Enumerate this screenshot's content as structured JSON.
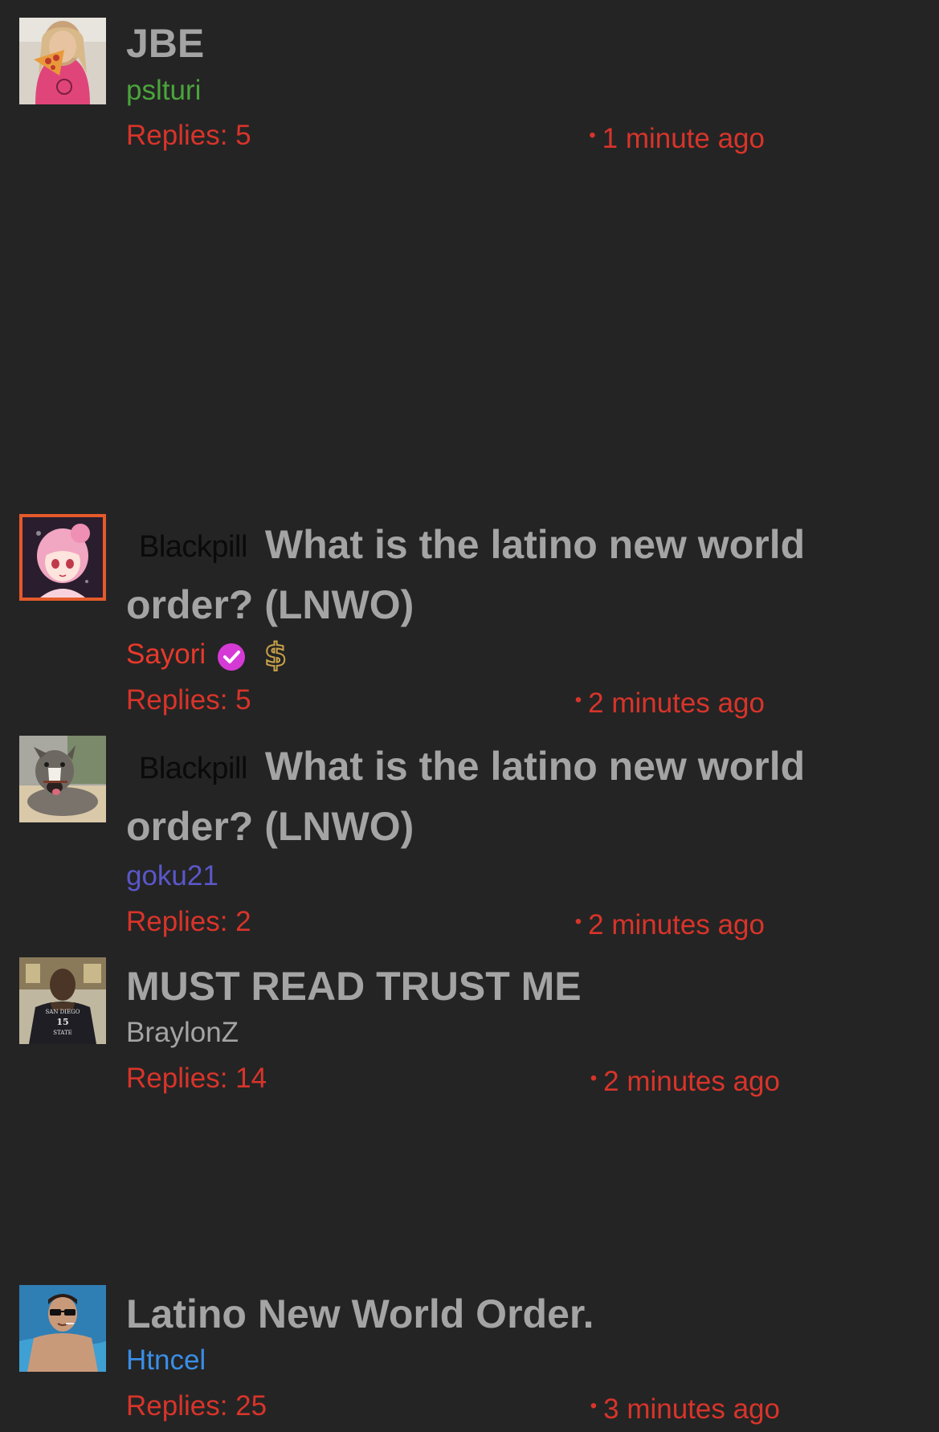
{
  "threads": [
    {
      "title": "JBE",
      "tag": "",
      "author": "pslturi",
      "author_color": "#4aa53b",
      "verified": false,
      "donor": false,
      "replies_label": "Replies: 5",
      "time_label": "1 minute ago",
      "avatar": "girl-eating-pizza-avatar"
    },
    {
      "title": "What is the latino new world order? (LNWO)",
      "tag": "Blackpill",
      "author": "Sayori",
      "author_color": "#e8392b",
      "verified": true,
      "donor": true,
      "replies_label": "Replies: 5",
      "time_label": "2 minutes ago",
      "avatar": "anime-girl-avatar"
    },
    {
      "title": "What is the latino new world order? (LNWO)",
      "tag": "Blackpill",
      "author": "goku21",
      "author_color": "#5a57c9",
      "verified": false,
      "donor": false,
      "replies_label": "Replies: 2",
      "time_label": "2 minutes ago",
      "avatar": "dog-avatar"
    },
    {
      "title": "MUST READ TRUST ME",
      "tag": "",
      "author": "BraylonZ",
      "author_color": "#a4a4a4",
      "verified": false,
      "donor": false,
      "replies_label": "Replies: 14",
      "time_label": "2 minutes ago",
      "avatar": "basketball-player-avatar"
    },
    {
      "title": "Latino New World Order.",
      "tag": "",
      "author": "Htncel",
      "author_color": "#3a8ee6",
      "verified": false,
      "donor": false,
      "replies_label": "Replies: 25",
      "time_label": "3 minutes ago",
      "avatar": "pool-man-avatar"
    }
  ],
  "colors": {
    "background": "#242424",
    "title": "#a4a4a4",
    "meta": "#d8342a",
    "verified_badge": "#d63ad6",
    "donor_badge": "#c9a24a"
  }
}
